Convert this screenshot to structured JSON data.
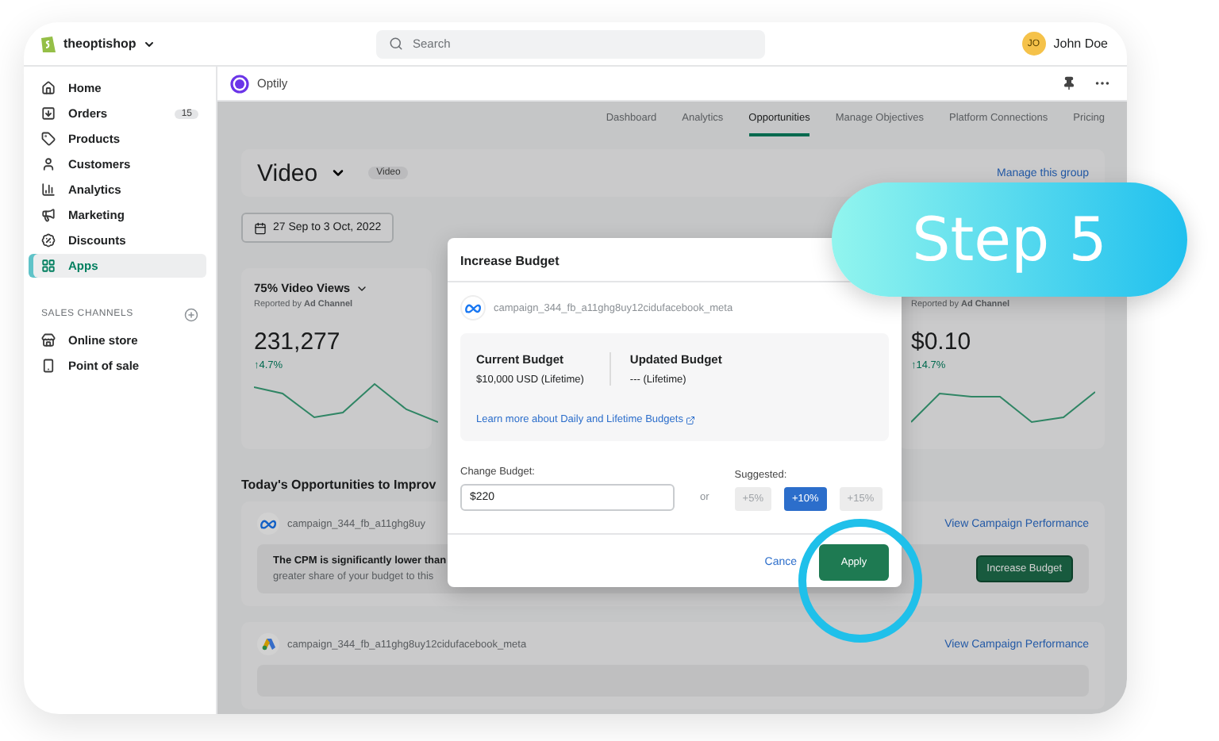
{
  "topbar": {
    "store": "theoptishop",
    "search": {
      "placeholder": "Search"
    },
    "user": {
      "initials": "JO",
      "name": "John Doe"
    }
  },
  "sidebar": {
    "items": [
      {
        "label": "Home",
        "selected": false
      },
      {
        "label": "Orders",
        "selected": false,
        "badge": "15"
      },
      {
        "label": "Products",
        "selected": false
      },
      {
        "label": "Customers",
        "selected": false
      },
      {
        "label": "Analytics",
        "selected": false
      },
      {
        "label": "Marketing",
        "selected": false
      },
      {
        "label": "Discounts",
        "selected": false
      },
      {
        "label": "Apps",
        "selected": true
      }
    ],
    "section_title": "SALES CHANNELS",
    "channels": [
      {
        "label": "Online store"
      },
      {
        "label": "Point of sale"
      }
    ]
  },
  "app_bar": {
    "title": "Optily"
  },
  "tabs": [
    {
      "label": "Dashboard",
      "selected": false
    },
    {
      "label": "Analytics",
      "selected": false
    },
    {
      "label": "Opportunities",
      "selected": true
    },
    {
      "label": "Manage Objectives",
      "selected": false
    },
    {
      "label": "Platform Connections",
      "selected": false
    },
    {
      "label": "Pricing",
      "selected": false
    }
  ],
  "header": {
    "title": "Video",
    "badge": "Video",
    "link": "Manage this group"
  },
  "date_range": "27 Sep to 3 Oct, 2022",
  "metrics": [
    {
      "title": "75% Video Views",
      "source": "Reported by **Ad Channel**",
      "value": "231,277",
      "change": "↑4.7%"
    },
    {
      "source": "Reported by **Ad Channel**",
      "value": "$0.10",
      "change": "↑14.7%"
    }
  ],
  "opportunities": {
    "title": "Today's Opportunities to Improv",
    "items": [
      {
        "kind": "meta",
        "campaign": "campaign_344_fb_a11ghg8uy",
        "link": "View Campaign Performance",
        "headline": "The CPM is significantly lower than",
        "body": "greater share of your budget to this",
        "action": "Increase Budget"
      },
      {
        "kind": "google",
        "campaign": "campaign_344_fb_a11ghg8uy12cidufacebook_meta",
        "link": "View Campaign Performance"
      }
    ]
  },
  "modal": {
    "title": "Increase Budget",
    "campaign": "campaign_344_fb_a11ghg8uy12cidufacebook_meta",
    "current": {
      "label": "Current Budget",
      "value": "$10,000 USD (Lifetime)"
    },
    "updated": {
      "label": "Updated Budget",
      "value": "--- (Lifetime)"
    },
    "learn_more": "Learn more about Daily and Lifetime Budgets",
    "change_label": "Change Budget:",
    "value": "$220",
    "or": "or",
    "suggested_label": "Suggested:",
    "suggestions": [
      {
        "label": "+5%",
        "selected": false
      },
      {
        "label": "+10%",
        "selected": true
      },
      {
        "label": "+15%",
        "selected": false
      }
    ],
    "cancel": "Cance",
    "apply": "Apply"
  },
  "callout": {
    "label": "Step 5"
  }
}
